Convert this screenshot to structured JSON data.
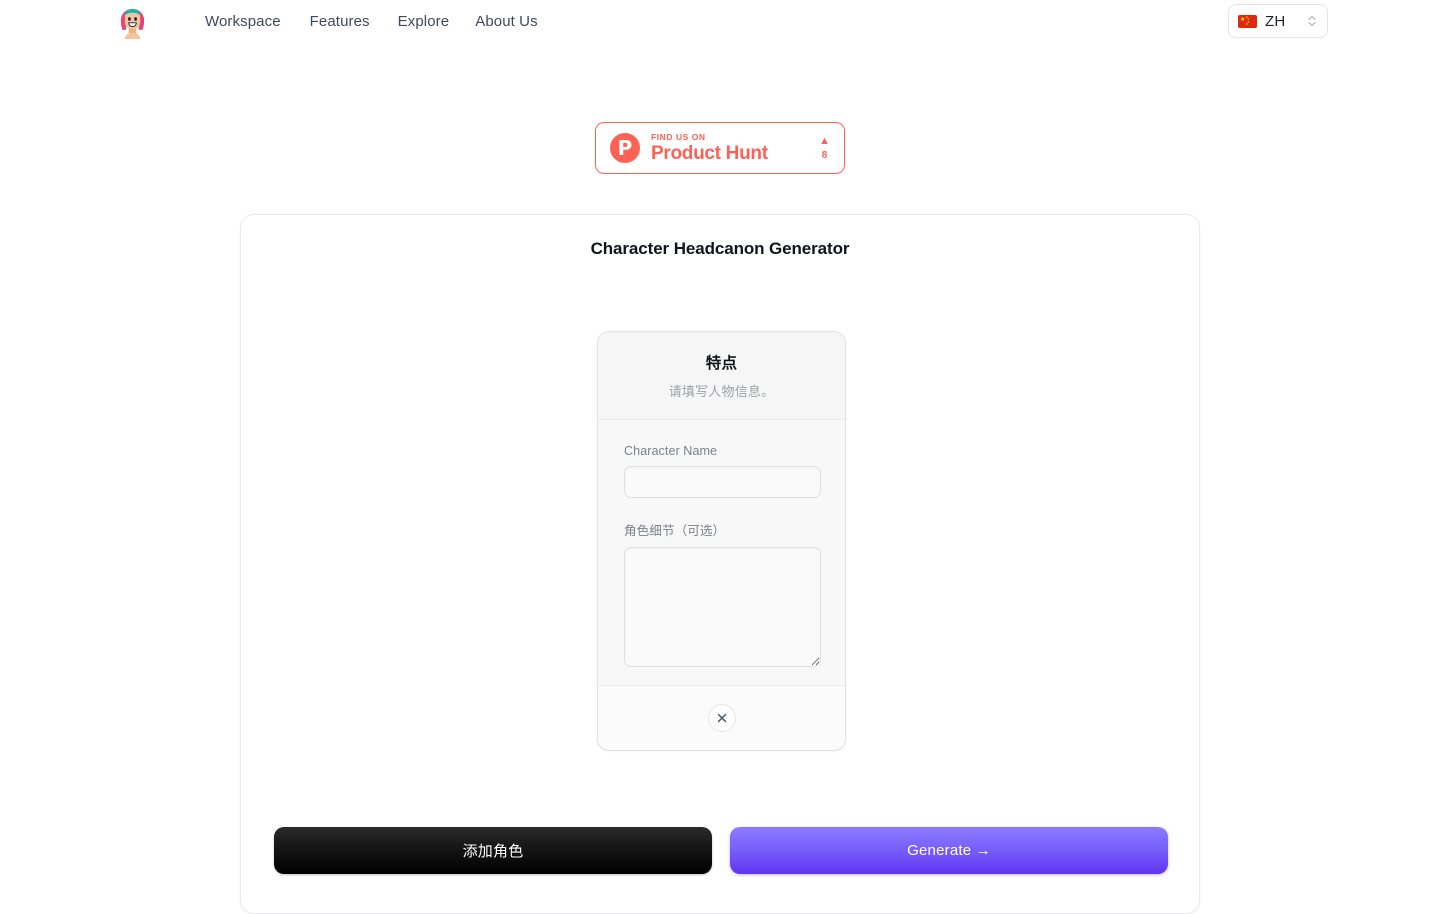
{
  "nav": {
    "logo_icon": "avatar-logo-icon",
    "links": [
      {
        "label": "Workspace"
      },
      {
        "label": "Features"
      },
      {
        "label": "Explore"
      },
      {
        "label": "About Us"
      }
    ],
    "language": {
      "flag_icon": "flag-cn-icon",
      "code": "ZH",
      "chevron_icon": "chevron-updown-icon"
    }
  },
  "product_hunt": {
    "logo_letter": "P",
    "kicker": "FIND US ON",
    "name": "Product Hunt",
    "upvote_arrow": "▲",
    "upvote_count": "8"
  },
  "main": {
    "title": "Character Headcanon Generator",
    "form_card": {
      "heading": "特点",
      "subheading": "请填写人物信息。",
      "fields": [
        {
          "label": "Character Name",
          "value": "",
          "placeholder": "",
          "type": "input"
        },
        {
          "label": "角色细节（可选）",
          "value": "",
          "placeholder": "",
          "type": "textarea"
        }
      ],
      "remove_icon": "close-x-icon"
    },
    "actions": {
      "add_label": "添加角色",
      "generate_label": "Generate →"
    }
  },
  "colors": {
    "accent_purple": "#6035f2",
    "product_hunt_red": "#ff6154",
    "nav_text": "#3e4a5c",
    "muted_text": "#9ea1a8",
    "card_border": "#eaeaec"
  }
}
